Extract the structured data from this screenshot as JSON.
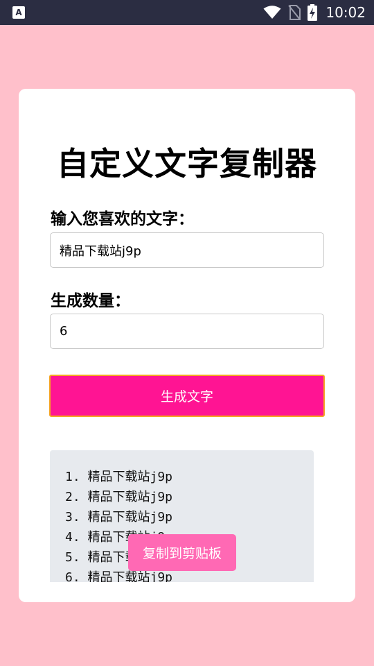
{
  "status_bar": {
    "app_icon_letter": "A",
    "time": "10:02",
    "icons": [
      "wifi-icon",
      "no-sim-icon",
      "battery-charging-icon"
    ]
  },
  "main": {
    "title": "自定义文字复制器",
    "text_label": "输入您喜欢的文字：",
    "text_value": "精品下载站j9p",
    "count_label": "生成数量：",
    "count_value": "6",
    "generate_label": "生成文字",
    "output_lines": [
      "1. 精品下载站j9p",
      "2. 精品下载站j9p",
      "3. 精品下载站j9p",
      "4. 精品下载站j9p",
      "5. 精品下载站j9p",
      "6. 精品下载站j9p"
    ],
    "copy_label": "复制到剪贴板"
  },
  "colors": {
    "background": "#ffc0cb",
    "status_bar": "#2b2d42",
    "generate_button": "#ff1493",
    "generate_border": "#f5a623",
    "copy_button": "#ff69b4",
    "output_bg": "#e7eaee"
  }
}
